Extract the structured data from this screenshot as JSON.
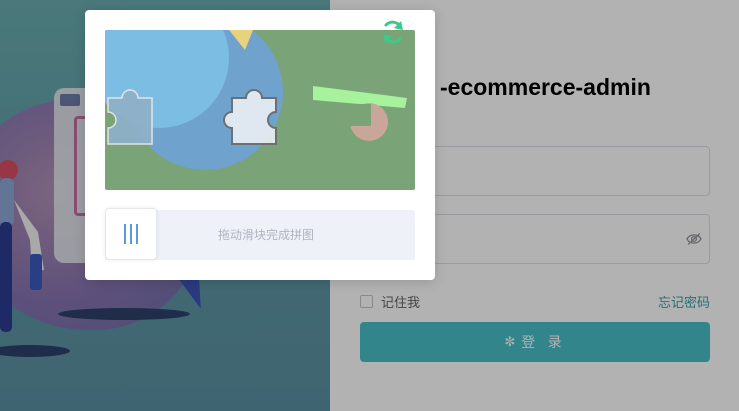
{
  "login": {
    "title": "-ecommerce-admin",
    "username_value": "",
    "password_value": "",
    "remember_label": "记住我",
    "forgot_label": "忘记密码",
    "login_button_label": "登 录"
  },
  "captcha": {
    "hint": "拖动滑块完成拼图"
  },
  "icons": {
    "refresh": "refresh-icon",
    "slider_handle": "bars-icon",
    "password_toggle": "eye-icon",
    "loading": "gear-icon"
  },
  "colors": {
    "accent": "#48c1c8",
    "link": "#3a9ea3",
    "refresh": "#3ec98a",
    "slider_track": "#eff1f8",
    "slider_bars": "#5b9bd8"
  }
}
